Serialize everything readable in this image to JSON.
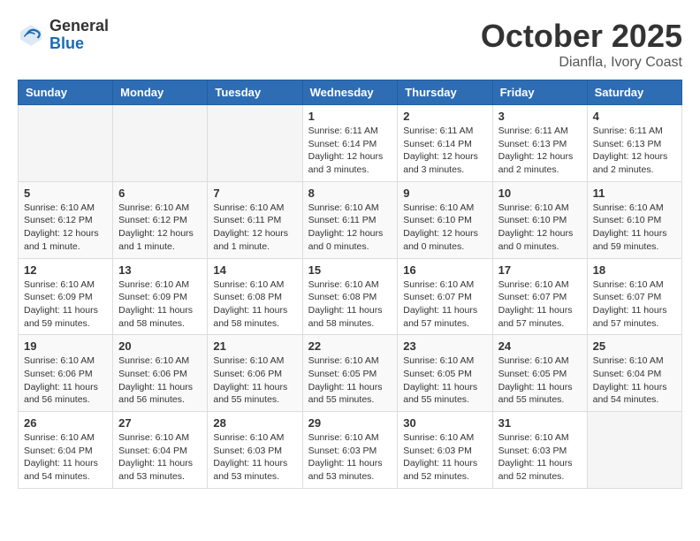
{
  "header": {
    "logo_general": "General",
    "logo_blue": "Blue",
    "month": "October 2025",
    "location": "Dianfla, Ivory Coast"
  },
  "weekdays": [
    "Sunday",
    "Monday",
    "Tuesday",
    "Wednesday",
    "Thursday",
    "Friday",
    "Saturday"
  ],
  "weeks": [
    [
      {
        "day": "",
        "info": ""
      },
      {
        "day": "",
        "info": ""
      },
      {
        "day": "",
        "info": ""
      },
      {
        "day": "1",
        "info": "Sunrise: 6:11 AM\nSunset: 6:14 PM\nDaylight: 12 hours and 3 minutes."
      },
      {
        "day": "2",
        "info": "Sunrise: 6:11 AM\nSunset: 6:14 PM\nDaylight: 12 hours and 3 minutes."
      },
      {
        "day": "3",
        "info": "Sunrise: 6:11 AM\nSunset: 6:13 PM\nDaylight: 12 hours and 2 minutes."
      },
      {
        "day": "4",
        "info": "Sunrise: 6:11 AM\nSunset: 6:13 PM\nDaylight: 12 hours and 2 minutes."
      }
    ],
    [
      {
        "day": "5",
        "info": "Sunrise: 6:10 AM\nSunset: 6:12 PM\nDaylight: 12 hours and 1 minute."
      },
      {
        "day": "6",
        "info": "Sunrise: 6:10 AM\nSunset: 6:12 PM\nDaylight: 12 hours and 1 minute."
      },
      {
        "day": "7",
        "info": "Sunrise: 6:10 AM\nSunset: 6:11 PM\nDaylight: 12 hours and 1 minute."
      },
      {
        "day": "8",
        "info": "Sunrise: 6:10 AM\nSunset: 6:11 PM\nDaylight: 12 hours and 0 minutes."
      },
      {
        "day": "9",
        "info": "Sunrise: 6:10 AM\nSunset: 6:10 PM\nDaylight: 12 hours and 0 minutes."
      },
      {
        "day": "10",
        "info": "Sunrise: 6:10 AM\nSunset: 6:10 PM\nDaylight: 12 hours and 0 minutes."
      },
      {
        "day": "11",
        "info": "Sunrise: 6:10 AM\nSunset: 6:10 PM\nDaylight: 11 hours and 59 minutes."
      }
    ],
    [
      {
        "day": "12",
        "info": "Sunrise: 6:10 AM\nSunset: 6:09 PM\nDaylight: 11 hours and 59 minutes."
      },
      {
        "day": "13",
        "info": "Sunrise: 6:10 AM\nSunset: 6:09 PM\nDaylight: 11 hours and 58 minutes."
      },
      {
        "day": "14",
        "info": "Sunrise: 6:10 AM\nSunset: 6:08 PM\nDaylight: 11 hours and 58 minutes."
      },
      {
        "day": "15",
        "info": "Sunrise: 6:10 AM\nSunset: 6:08 PM\nDaylight: 11 hours and 58 minutes."
      },
      {
        "day": "16",
        "info": "Sunrise: 6:10 AM\nSunset: 6:07 PM\nDaylight: 11 hours and 57 minutes."
      },
      {
        "day": "17",
        "info": "Sunrise: 6:10 AM\nSunset: 6:07 PM\nDaylight: 11 hours and 57 minutes."
      },
      {
        "day": "18",
        "info": "Sunrise: 6:10 AM\nSunset: 6:07 PM\nDaylight: 11 hours and 57 minutes."
      }
    ],
    [
      {
        "day": "19",
        "info": "Sunrise: 6:10 AM\nSunset: 6:06 PM\nDaylight: 11 hours and 56 minutes."
      },
      {
        "day": "20",
        "info": "Sunrise: 6:10 AM\nSunset: 6:06 PM\nDaylight: 11 hours and 56 minutes."
      },
      {
        "day": "21",
        "info": "Sunrise: 6:10 AM\nSunset: 6:06 PM\nDaylight: 11 hours and 55 minutes."
      },
      {
        "day": "22",
        "info": "Sunrise: 6:10 AM\nSunset: 6:05 PM\nDaylight: 11 hours and 55 minutes."
      },
      {
        "day": "23",
        "info": "Sunrise: 6:10 AM\nSunset: 6:05 PM\nDaylight: 11 hours and 55 minutes."
      },
      {
        "day": "24",
        "info": "Sunrise: 6:10 AM\nSunset: 6:05 PM\nDaylight: 11 hours and 55 minutes."
      },
      {
        "day": "25",
        "info": "Sunrise: 6:10 AM\nSunset: 6:04 PM\nDaylight: 11 hours and 54 minutes."
      }
    ],
    [
      {
        "day": "26",
        "info": "Sunrise: 6:10 AM\nSunset: 6:04 PM\nDaylight: 11 hours and 54 minutes."
      },
      {
        "day": "27",
        "info": "Sunrise: 6:10 AM\nSunset: 6:04 PM\nDaylight: 11 hours and 53 minutes."
      },
      {
        "day": "28",
        "info": "Sunrise: 6:10 AM\nSunset: 6:03 PM\nDaylight: 11 hours and 53 minutes."
      },
      {
        "day": "29",
        "info": "Sunrise: 6:10 AM\nSunset: 6:03 PM\nDaylight: 11 hours and 53 minutes."
      },
      {
        "day": "30",
        "info": "Sunrise: 6:10 AM\nSunset: 6:03 PM\nDaylight: 11 hours and 52 minutes."
      },
      {
        "day": "31",
        "info": "Sunrise: 6:10 AM\nSunset: 6:03 PM\nDaylight: 11 hours and 52 minutes."
      },
      {
        "day": "",
        "info": ""
      }
    ]
  ]
}
